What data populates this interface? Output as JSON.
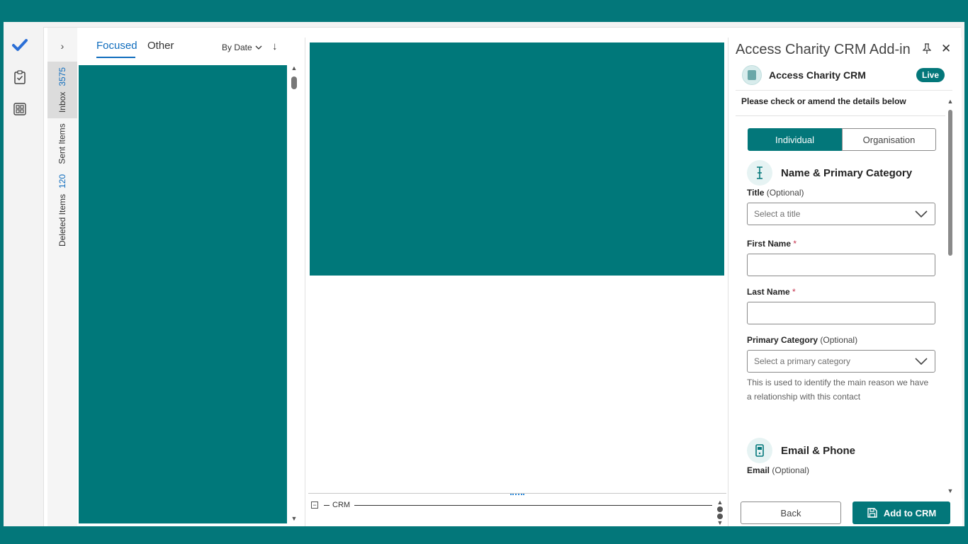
{
  "colors": {
    "accent": "#03777a",
    "link": "#0f6cbd",
    "required": "#c4314b"
  },
  "rail": {
    "icons": [
      "todo-check-icon",
      "clipboard-icon",
      "apps-grid-icon"
    ]
  },
  "folders": {
    "inbox": {
      "label": "Inbox",
      "count": "3575"
    },
    "sent": {
      "label": "Sent Items"
    },
    "deleted": {
      "label": "Deleted Items",
      "count": "120"
    }
  },
  "mail_list": {
    "tabs": [
      "Focused",
      "Other"
    ],
    "sort_label": "By Date",
    "sort_direction_icon": "arrow-down-icon"
  },
  "crm_bar": {
    "label": "CRM"
  },
  "addin": {
    "title": "Access Charity CRM Add-in",
    "brand_name": "Access Charity CRM",
    "status_badge": "Live",
    "instructions": "Please check or amend the details below",
    "toggle": {
      "individual": "Individual",
      "organisation": "Organisation"
    },
    "section_name": "Name & Primary Category",
    "title_label": "Title",
    "optional_text": "(Optional)",
    "title_placeholder": "Select a title",
    "first_name_label": "First Name",
    "last_name_label": "Last Name",
    "required_mark": "*",
    "first_name_value": "",
    "last_name_value": "",
    "primary_category_label": "Primary Category",
    "primary_category_placeholder": "Select a primary category",
    "primary_category_help": "This is used to identify the main reason we have a relationship with this contact",
    "section_email": "Email & Phone",
    "email_label": "Email",
    "back_button": "Back",
    "add_button": "Add to CRM"
  }
}
